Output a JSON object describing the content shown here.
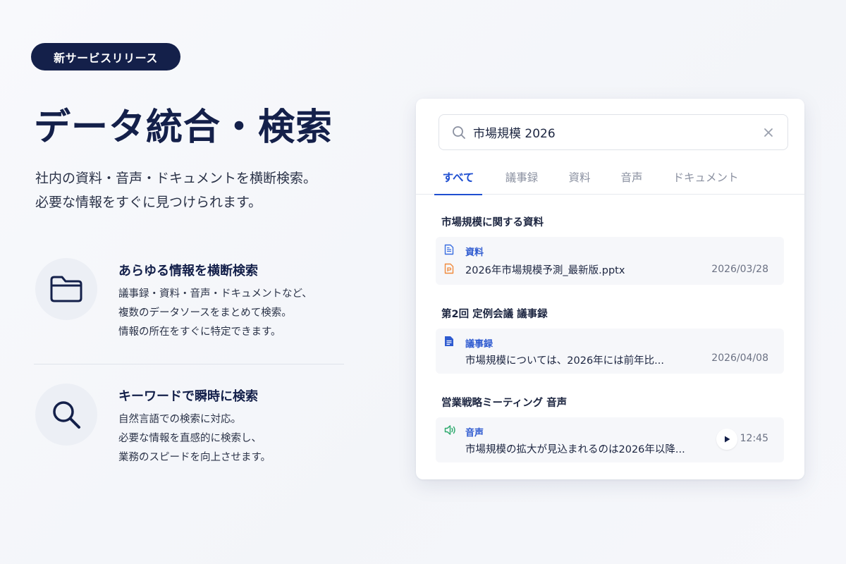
{
  "badge": "新サービスリリース",
  "hero": {
    "title": "データ統合・検索",
    "subtitle_lines": [
      "社内の資料・音声・ドキュメントを横断検索。",
      "必要な情報をすぐに見つけられます。"
    ]
  },
  "features": [
    {
      "icon": "folder-icon",
      "title": "あらゆる情報を横断検索",
      "desc_lines": [
        "議事録・資料・音声・ドキュメントなど、",
        "複数のデータソースをまとめて検索。",
        "情報の所在をすぐに特定できます。"
      ]
    },
    {
      "icon": "search-icon",
      "title": "キーワードで瞬時に検索",
      "desc_lines": [
        "自然言語での検索に対応。",
        "必要な情報を直感的に検索し、",
        "業務のスピードを向上させます。"
      ]
    }
  ],
  "search": {
    "query": "市場規模 2026"
  },
  "tabs": [
    {
      "label": "すべて",
      "active": true
    },
    {
      "label": "議事録",
      "active": false
    },
    {
      "label": "資料",
      "active": false
    },
    {
      "label": "音声",
      "active": false
    },
    {
      "label": "ドキュメント",
      "active": false
    }
  ],
  "results": [
    {
      "group": "市場規模に関する資料",
      "type_label": "資料",
      "type_icon": "document-outline-icon",
      "file_icon": "pptx-file-icon",
      "text": "2026年市場規模予測_最新版.pptx",
      "date": "2026/03/28"
    },
    {
      "group": "第2回 定例会議 議事録",
      "type_label": "議事録",
      "type_icon": "document-filled-icon",
      "text": "市場規模については、2026年には前年比...",
      "date": "2026/04/08"
    },
    {
      "group": "営業戦略ミーティング 音声",
      "type_label": "音声",
      "type_icon": "speaker-icon",
      "text": "市場規模の拡大が見込まれるのは2026年以降...",
      "duration": "12:45"
    }
  ],
  "colors": {
    "navy": "#14204a",
    "accent_blue": "#1f4fd1",
    "pptx_orange": "#f08a3c",
    "audio_green": "#2faa6e"
  }
}
